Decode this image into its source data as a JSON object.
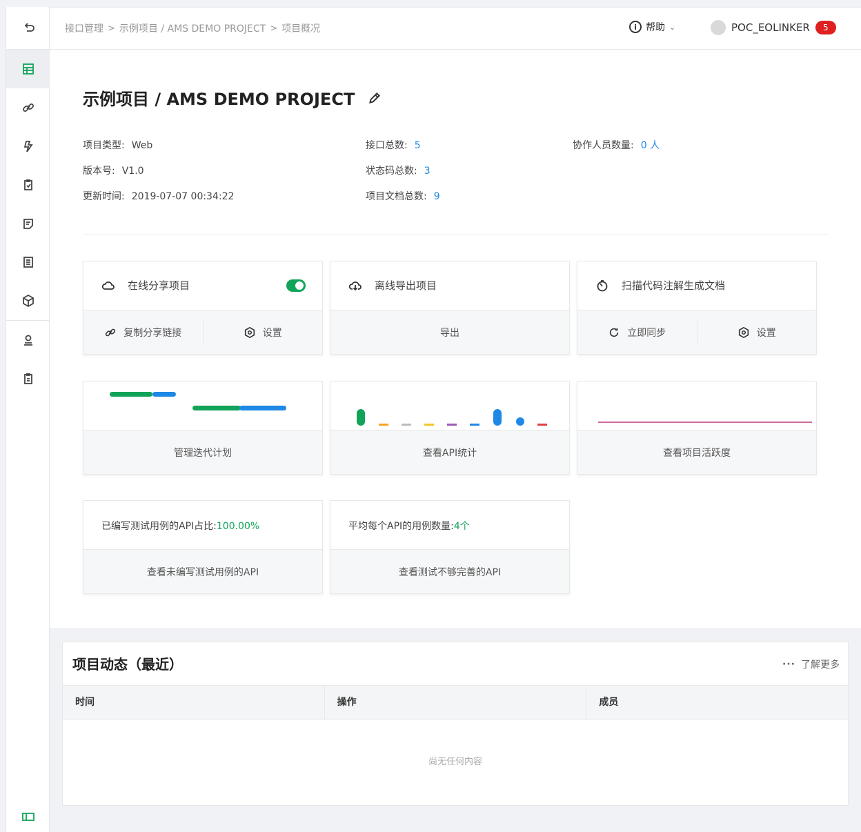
{
  "breadcrumb": [
    "接口管理",
    "示例项目 / AMS DEMO PROJECT",
    "项目概况"
  ],
  "header": {
    "help_label": "帮助",
    "username": "POC_EOLINKER",
    "badge": "5"
  },
  "project": {
    "title": "示例项目 / AMS DEMO PROJECT",
    "type_label": "项目类型:",
    "type_value": "Web",
    "version_label": "版本号:",
    "version_value": "V1.0",
    "updated_label": "更新时间:",
    "updated_value": "2019-07-07 00:34:22",
    "api_total_label": "接口总数:",
    "api_total_value": "5",
    "status_code_label": "状态码总数:",
    "status_code_value": "3",
    "doc_total_label": "项目文档总数:",
    "doc_total_value": "9",
    "collab_label": "协作人员数量:",
    "collab_value": "0 人"
  },
  "cards": {
    "share": {
      "title": "在线分享项目",
      "toggle_on": true,
      "copy_label": "复制分享链接",
      "settings_label": "设置"
    },
    "export": {
      "title": "离线导出项目",
      "action_label": "导出"
    },
    "scan": {
      "title": "扫描代码注解生成文档",
      "sync_label": "立即同步",
      "settings_label": "设置"
    },
    "iteration": {
      "action_label": "管理迭代计划"
    },
    "api_stats": {
      "action_label": "查看API统计"
    },
    "activity_chart": {
      "action_label": "查看项目活跃度"
    },
    "test_ratio": {
      "label": "已编写测试用例的API占比:",
      "value": "100.00%",
      "action_label": "查看未编写测试用例的API"
    },
    "test_avg": {
      "label": "平均每个API的用例数量:",
      "value": "4个",
      "action_label": "查看测试不够完善的API"
    }
  },
  "activity": {
    "title": "项目动态（最近）",
    "more_label": "了解更多",
    "columns": [
      "时间",
      "操作",
      "成员"
    ],
    "empty_text": "尚无任何内容"
  },
  "colors": {
    "accent": "#12a35a",
    "link": "#1e88e5",
    "badge": "#e02020"
  }
}
